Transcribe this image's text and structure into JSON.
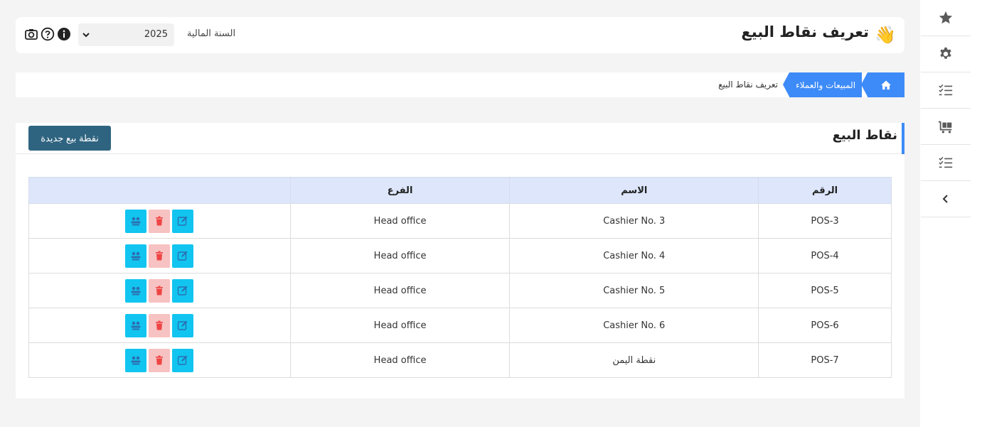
{
  "header": {
    "title": "تعريف نقاط البيع",
    "wave_icon": "👋",
    "fiscal_year_label": "السنة المالية",
    "fiscal_year_value": "2025"
  },
  "breadcrumb": {
    "home_icon": "home-icon",
    "section": "المبيعات والعملاء",
    "current": "تعريف نقاط البيع"
  },
  "card": {
    "title": "نقاط البيع",
    "new_button": "نقطة بيع جديدة"
  },
  "table": {
    "headers": {
      "number": "الرقم",
      "name": "الاسم",
      "branch": "الفرع",
      "actions": ""
    },
    "rows": [
      {
        "number": "POS-3",
        "name": "Cashier No. 3",
        "branch": "Head office"
      },
      {
        "number": "POS-4",
        "name": "Cashier No. 4",
        "branch": "Head office"
      },
      {
        "number": "POS-5",
        "name": "Cashier No. 5",
        "branch": "Head office"
      },
      {
        "number": "POS-6",
        "name": "Cashier No. 6",
        "branch": "Head office"
      },
      {
        "number": "POS-7",
        "name": "نقطة اليمن",
        "branch": "Head office"
      }
    ]
  },
  "sidebar": {
    "items": [
      "star-icon",
      "gear-icon",
      "checklist-icon",
      "cart-icon",
      "checklist-icon",
      "chevron-left-icon"
    ]
  },
  "colors": {
    "accent": "#3d8bf8",
    "primary_button": "#2f6480",
    "action_cyan": "#11c5f0",
    "action_delete_bg": "#f7c2c2",
    "table_header_bg": "#dde6fb"
  }
}
